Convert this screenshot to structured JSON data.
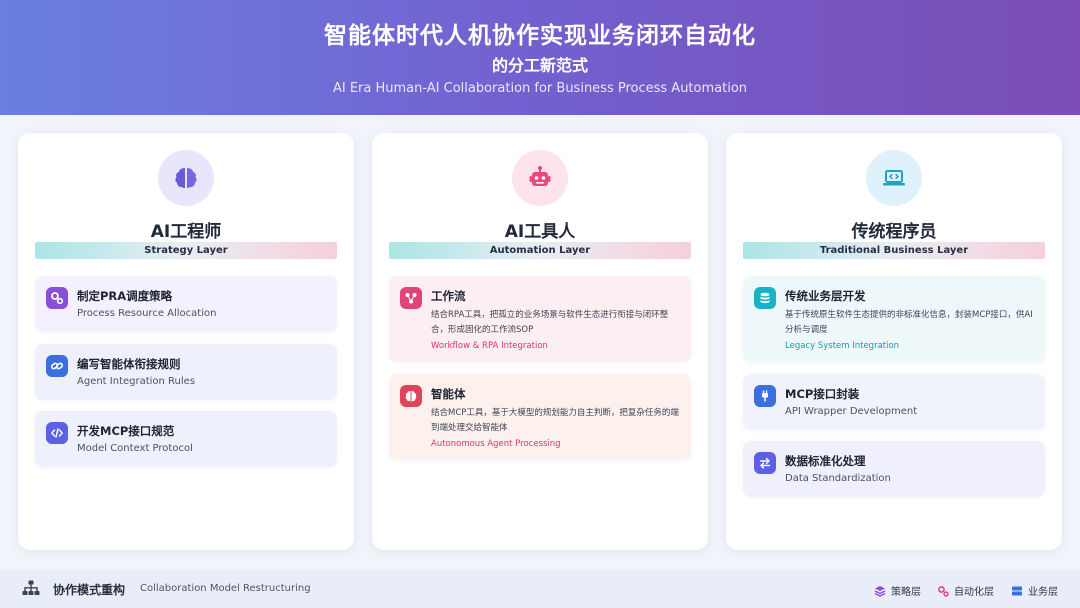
{
  "header": {
    "title_line1": "智能体时代人机协作实现业务闭环自动化",
    "title_line2": "的分工新范式",
    "subtitle": "AI Era Human-AI Collaboration for Business Process Automation"
  },
  "columns": [
    {
      "icon": "brain-icon",
      "title": "AI工程师",
      "layer": "Strategy Layer",
      "items": [
        {
          "icon": "gears-icon",
          "title": "制定PRA调度策略",
          "subtitle": "Process Resource Allocation"
        },
        {
          "icon": "link-icon",
          "title": "编写智能体衔接规则",
          "subtitle": "Agent Integration Rules"
        },
        {
          "icon": "code-icon",
          "title": "开发MCP接口规范",
          "subtitle": "Model Context Protocol"
        }
      ]
    },
    {
      "icon": "robot-icon",
      "title": "AI工具人",
      "layer": "Automation Layer",
      "items": [
        {
          "icon": "workflow-icon",
          "title": "工作流",
          "description": "结合RPA工具，把孤立的业务场景与软件生态进行衔接与闭环整合，形成固化的工作流SOP",
          "english": "Workflow & RPA Integration"
        },
        {
          "icon": "brain-icon",
          "title": "智能体",
          "description": "结合MCP工具，基于大模型的规划能力自主判断，把复杂任务的端到端处理交给智能体",
          "english": "Autonomous Agent Processing"
        }
      ]
    },
    {
      "icon": "laptop-code-icon",
      "title": "传统程序员",
      "layer": "Traditional Business Layer",
      "items": [
        {
          "icon": "database-icon",
          "title": "传统业务层开发",
          "description": "基于传统原生软件生态提供的非标准化信息，封装MCP接口，供AI分析与调度",
          "english": "Legacy System Integration"
        },
        {
          "icon": "plug-icon",
          "title": "MCP接口封装",
          "subtitle": "API Wrapper Development"
        },
        {
          "icon": "exchange-icon",
          "title": "数据标准化处理",
          "subtitle": "Data Standardization"
        }
      ]
    }
  ],
  "footer": {
    "icon": "sitemap-icon",
    "title": "协作模式重构",
    "subtitle": "Collaboration Model Restructuring",
    "legend": [
      {
        "icon": "layers-icon",
        "label": "策略层",
        "color": "#8a4fd8"
      },
      {
        "icon": "gears-icon",
        "label": "自动化层",
        "color": "#e0447a"
      },
      {
        "icon": "server-icon",
        "label": "业务层",
        "color": "#3b6fe0"
      }
    ]
  },
  "colors": {
    "header_start": "#6a7fe0",
    "header_end": "#7a4cb4",
    "purple": "#8a4fd8",
    "blue": "#3b6fe0",
    "indigo": "#5b60e6",
    "pink": "#e0447a",
    "red": "#e0445a",
    "teal": "#17b3c6",
    "teal_text": "#159aa8",
    "pink_text": "#d9356a"
  }
}
